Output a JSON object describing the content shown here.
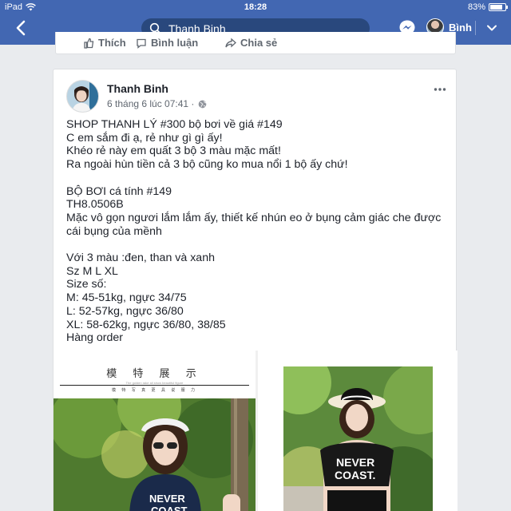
{
  "status_bar": {
    "device": "iPad",
    "time": "18:28",
    "battery": "83%",
    "battery_level": 0.83
  },
  "navbar": {
    "search_text": "Thanh Binh",
    "user_name": "Bình"
  },
  "prev_post_actions": [
    "Thích",
    "Bình luận",
    "Chia sẻ"
  ],
  "post": {
    "author": "Thanh Binh",
    "timestamp": "6 tháng 6 lúc 07:41 ·",
    "lines": [
      "SHOP THANH LÝ #300 bộ bơi về giá #149",
      "C em sắm đi ạ, rẻ như gì gì ấy!",
      "Khéo rẻ này em quất 3 bộ 3 màu mặc mất!",
      "Ra ngoài hùn tiền cả 3 bộ cũng ko mua nổi 1 bộ ấy chứ!",
      "",
      "BỘ BƠI cá tính #149",
      "TH8.0506B",
      "Mặc vô gọn ngươi lắm lắm ấy, thiết kế nhún eo ở bụng cảm giác che được",
      "cái bụng của mềnh",
      "",
      "Với 3 màu :đen, than và xanh",
      "Sz M L XL",
      "Size số:",
      "M: 45-51kg, ngực 34/75",
      "L: 52-57kg, ngực 36/80",
      "XL: 58-62kg, ngực 36/80, 38/85",
      "Hàng order"
    ],
    "photo1": {
      "title": "模 特 展 示",
      "subtitle_small": "The golden rake all show beautiful figure",
      "subtitle": "模 特 写 真 更 具 说 服 力",
      "shirt_text_1": "NEVER",
      "shirt_text_2": "COAST"
    },
    "photo2": {
      "shirt_text_1": "NEVER",
      "shirt_text_2": "COAST."
    }
  }
}
